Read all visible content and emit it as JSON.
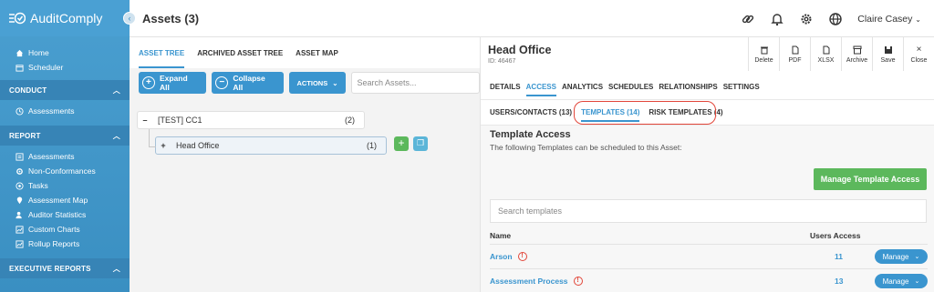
{
  "app": {
    "name": "AuditComply"
  },
  "sidebar": {
    "top_items": [
      {
        "label": "Home",
        "icon": "home-icon"
      },
      {
        "label": "Scheduler",
        "icon": "calendar-icon"
      }
    ],
    "sections": [
      {
        "title": "CONDUCT",
        "items": [
          {
            "label": "Assessments",
            "icon": "clock-icon"
          }
        ]
      },
      {
        "title": "REPORT",
        "items": [
          {
            "label": "Assessments",
            "icon": "list-icon"
          },
          {
            "label": "Non-Conformances",
            "icon": "gear-icon"
          },
          {
            "label": "Tasks",
            "icon": "target-icon"
          },
          {
            "label": "Assessment Map",
            "icon": "map-pin-icon"
          },
          {
            "label": "Auditor Statistics",
            "icon": "users-icon"
          },
          {
            "label": "Custom Charts",
            "icon": "chart-icon"
          },
          {
            "label": "Rollup Reports",
            "icon": "chart-icon"
          }
        ]
      },
      {
        "title": "EXECUTIVE REPORTS",
        "items": []
      }
    ]
  },
  "header": {
    "title": "Assets (3)",
    "user": "Claire Casey"
  },
  "left": {
    "tabs": [
      "ASSET TREE",
      "ARCHIVED ASSET TREE",
      "ASSET MAP"
    ],
    "expand_all": "Expand All",
    "collapse_all": "Collapse All",
    "actions": "ACTIONS",
    "search_placeholder": "Search Assets...",
    "tree": [
      {
        "toggle": "–",
        "name": "[TEST] CC1",
        "count": "(2)"
      },
      {
        "toggle": "+",
        "name": "Head Office",
        "count": "(1)"
      }
    ]
  },
  "right": {
    "title": "Head Office",
    "id_text": "ID: 46467",
    "actions": [
      "Delete",
      "PDF",
      "XLSX",
      "Archive",
      "Save",
      "Close"
    ],
    "tabs": [
      "DETAILS",
      "ACCESS",
      "ANALYTICS",
      "SCHEDULES",
      "RELATIONSHIPS",
      "SETTINGS"
    ],
    "subtabs": [
      "USERS/CONTACTS (13)",
      "TEMPLATES (14)",
      "RISK TEMPLATES (4)"
    ],
    "content_title": "Template Access",
    "content_sub": "The following Templates can be scheduled to this Asset:",
    "manage_access": "Manage Template Access",
    "search_placeholder": "Search templates",
    "col_name": "Name",
    "col_users": "Users Access",
    "rows": [
      {
        "name": "Arson",
        "count": "11",
        "button": "Manage"
      },
      {
        "name": "Assessment Process",
        "count": "13",
        "button": "Manage"
      }
    ]
  },
  "colors": {
    "accent": "#3a95cf",
    "green": "#5cb85c",
    "highlight": "#e2463a"
  }
}
